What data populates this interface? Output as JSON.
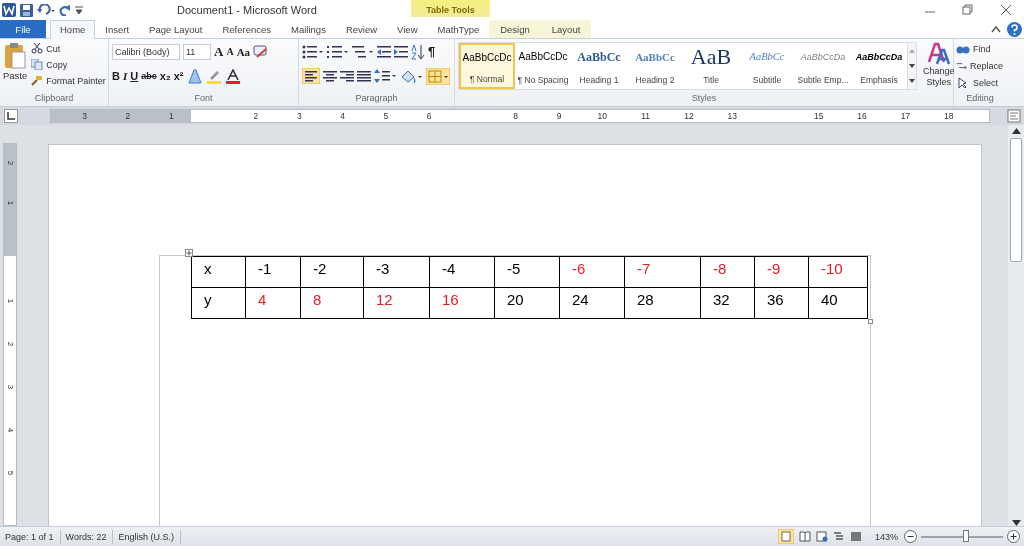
{
  "window": {
    "title": "Document1 - Microsoft Word",
    "contextual_label": "Table Tools"
  },
  "tabs": [
    {
      "label": "File",
      "kind": "file",
      "selected": false
    },
    {
      "label": "Home",
      "kind": "normal",
      "selected": true
    },
    {
      "label": "Insert",
      "kind": "normal",
      "selected": false
    },
    {
      "label": "Page Layout",
      "kind": "normal",
      "selected": false
    },
    {
      "label": "References",
      "kind": "normal",
      "selected": false
    },
    {
      "label": "Mailings",
      "kind": "normal",
      "selected": false
    },
    {
      "label": "Review",
      "kind": "normal",
      "selected": false
    },
    {
      "label": "View",
      "kind": "normal",
      "selected": false
    },
    {
      "label": "MathType",
      "kind": "normal",
      "selected": false
    },
    {
      "label": "Design",
      "kind": "contextual",
      "selected": false
    },
    {
      "label": "Layout",
      "kind": "contextual",
      "selected": false
    }
  ],
  "clipboard": {
    "label": "Clipboard",
    "paste": "Paste",
    "cut": "Cut",
    "copy": "Copy",
    "format_painter": "Format Painter"
  },
  "font": {
    "label": "Font",
    "family": "Calibri (Body)",
    "size": "11",
    "grow": "A",
    "shrink": "A",
    "case": "Aa",
    "bold": "B",
    "italic": "I",
    "underline": "U",
    "strike": "abc",
    "subscript": "x₂",
    "superscript": "x²"
  },
  "paragraph": {
    "label": "Paragraph",
    "pilcrow": "¶"
  },
  "styles": {
    "label": "Styles",
    "change_styles": "Change Styles",
    "items": [
      {
        "preview": "AaBbCcDc",
        "name": "¶ Normal",
        "kind": "normal",
        "selected": true
      },
      {
        "preview": "AaBbCcDc",
        "name": "¶ No Spacing",
        "kind": "normal",
        "selected": false
      },
      {
        "preview": "AaBbCc",
        "name": "Heading 1",
        "kind": "heading1",
        "selected": false
      },
      {
        "preview": "AaBbCc",
        "name": "Heading 2",
        "kind": "heading2",
        "selected": false
      },
      {
        "preview": "AaB",
        "name": "Title",
        "kind": "title",
        "selected": false
      },
      {
        "preview": "AaBbCc",
        "name": "Subtitle",
        "kind": "subtitle",
        "selected": false
      },
      {
        "preview": "AaBbCcDa",
        "name": "Subtle Emp...",
        "kind": "subtle",
        "selected": false
      },
      {
        "preview": "AaBbCcDa",
        "name": "Emphasis",
        "kind": "emphasis",
        "selected": false
      }
    ]
  },
  "editing": {
    "label": "Editing",
    "find": "Find",
    "replace": "Replace",
    "select": "Select"
  },
  "ruler": {
    "left_numbers": [
      "3",
      "2",
      "1"
    ],
    "segments": [
      [
        "2",
        "3",
        "4",
        "5",
        "6"
      ],
      [
        "8",
        "9",
        "10",
        "11",
        "12",
        "13"
      ],
      [
        "15",
        "16",
        "17",
        "18"
      ]
    ]
  },
  "vertical_ruler": {
    "top_numbers": [
      "2",
      "1"
    ],
    "numbers": [
      "1",
      "2",
      "3",
      "4",
      "5"
    ]
  },
  "table": {
    "rows": [
      [
        {
          "text": "x",
          "color": "#000000"
        },
        {
          "text": "-1",
          "color": "#000000"
        },
        {
          "text": "-2",
          "color": "#000000"
        },
        {
          "text": "-3",
          "color": "#000000"
        },
        {
          "text": "-4",
          "color": "#000000"
        },
        {
          "text": "-5",
          "color": "#000000"
        },
        {
          "text": "-6",
          "color": "#e81c24"
        },
        {
          "text": "-7",
          "color": "#e81c24"
        },
        {
          "text": "-8",
          "color": "#e81c24"
        },
        {
          "text": "-9",
          "color": "#e81c24"
        },
        {
          "text": "-10",
          "color": "#e81c24"
        }
      ],
      [
        {
          "text": "y",
          "color": "#000000"
        },
        {
          "text": "4",
          "color": "#e81c24"
        },
        {
          "text": "8",
          "color": "#e81c24"
        },
        {
          "text": "12",
          "color": "#e81c24"
        },
        {
          "text": "16",
          "color": "#e81c24"
        },
        {
          "text": "20",
          "color": "#000000"
        },
        {
          "text": "24",
          "color": "#000000"
        },
        {
          "text": "28",
          "color": "#000000"
        },
        {
          "text": "32",
          "color": "#000000"
        },
        {
          "text": "36",
          "color": "#000000"
        },
        {
          "text": "40",
          "color": "#000000"
        }
      ]
    ]
  },
  "status_bar": {
    "page": "Page: 1 of 1",
    "words": "Words: 22",
    "language": "English (U.S.)",
    "zoom": "143%",
    "zoom_slider": {
      "level": 0.55
    }
  }
}
